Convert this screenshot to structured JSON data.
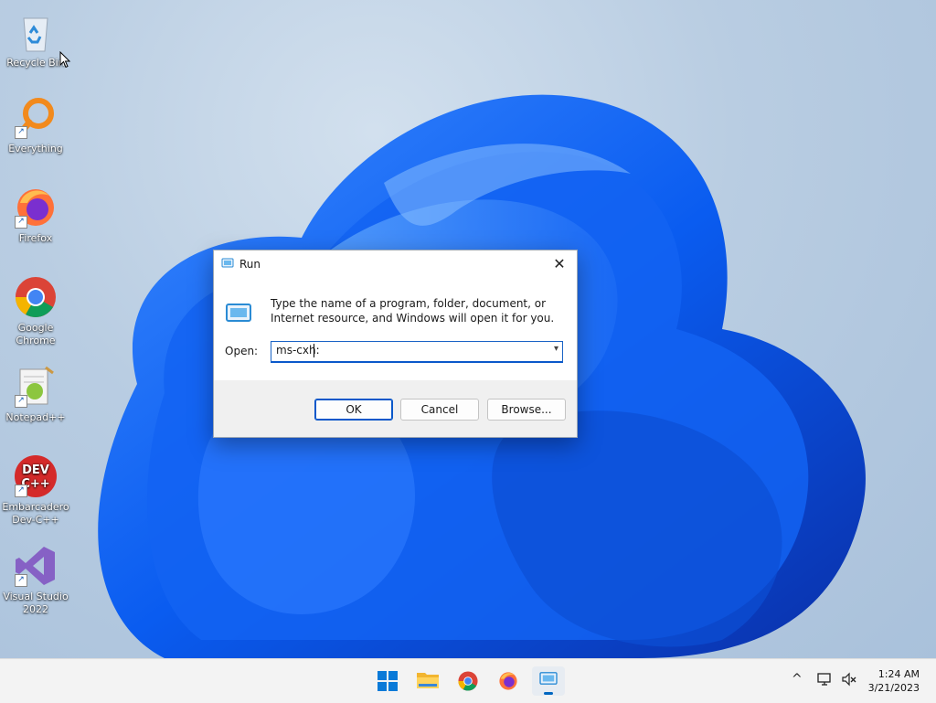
{
  "desktop": {
    "icons": [
      {
        "label": "Recycle Bin"
      },
      {
        "label": "Everything"
      },
      {
        "label": "Firefox"
      },
      {
        "label": "Google Chrome"
      },
      {
        "label": "Notepad++"
      },
      {
        "label": "Embarcadero Dev-C++"
      },
      {
        "label": "Visual Studio 2022"
      }
    ]
  },
  "dialog": {
    "title": "Run",
    "close_glyph": "✕",
    "description": "Type the name of a program, folder, document, or Internet resource, and Windows will open it for you.",
    "open_label": "Open:",
    "open_value": "ms-cxh:",
    "ok_label": "OK",
    "cancel_label": "Cancel",
    "browse_label": "Browse...",
    "accent": "#0a58ca"
  },
  "taskbar": {
    "items": [
      "start-icon",
      "file-explorer-icon",
      "chrome-icon",
      "firefox-icon",
      "run-icon"
    ],
    "active_item": "run-icon",
    "tray": {
      "chevron": "^"
    },
    "clock": {
      "time": "1:24 AM",
      "date": "3/21/2023"
    }
  }
}
